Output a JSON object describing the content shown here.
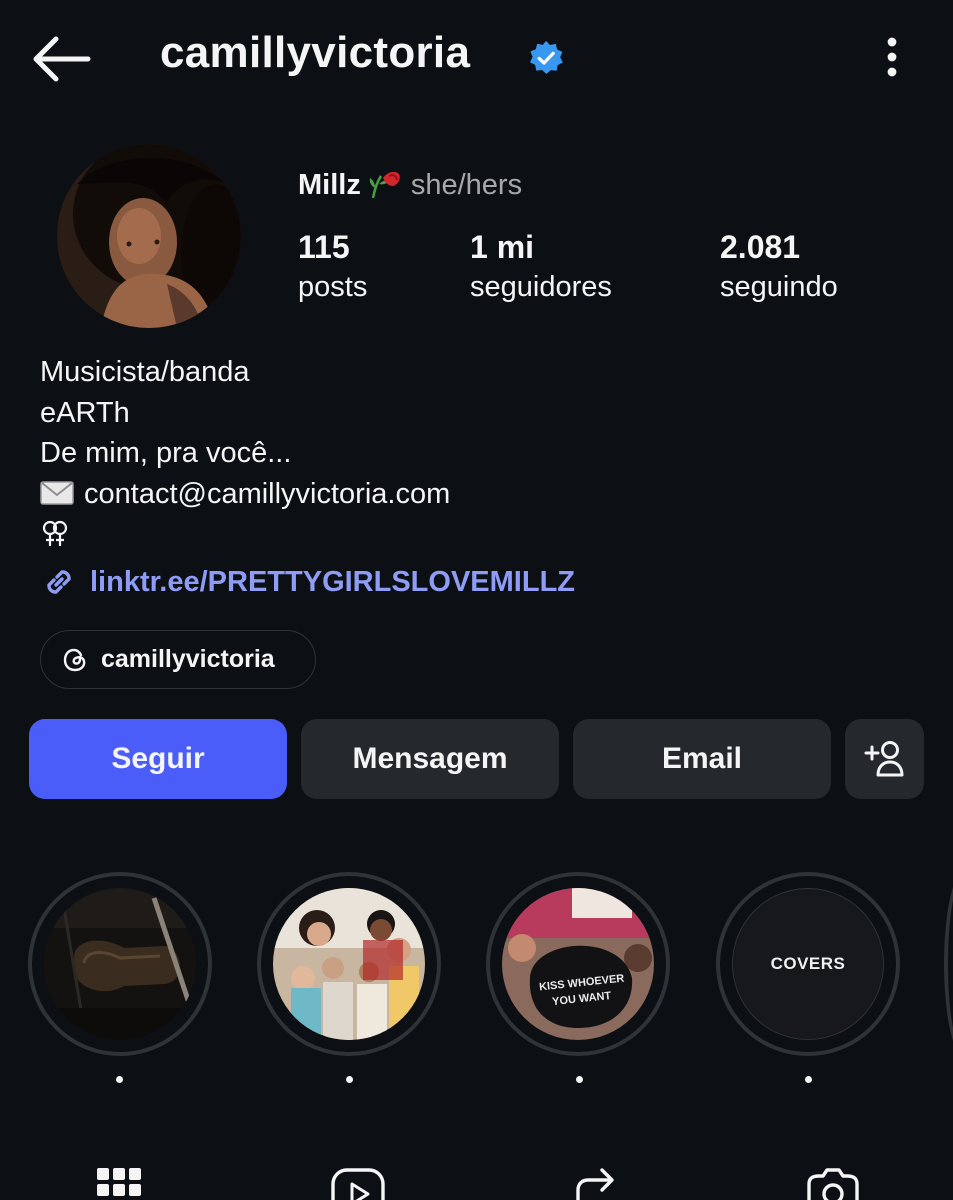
{
  "header": {
    "username": "camillyvictoria",
    "verified_color": "#3897f0"
  },
  "profile": {
    "display_name": "Millz",
    "pronouns": "she/hers",
    "stats": [
      {
        "num": "115",
        "label": "posts"
      },
      {
        "num": "1 mi",
        "label": "seguidores"
      },
      {
        "num": "2.081",
        "label": "seguindo"
      }
    ]
  },
  "bio": {
    "category": "Musicista/banda",
    "lines": [
      "eARTh",
      "De mim, pra você..."
    ],
    "contact": "contact@camillyvictoria.com",
    "link": "linktr.ee/PRETTYGIRLSLOVEMILLZ"
  },
  "threads": {
    "label": "camillyvictoria"
  },
  "buttons": {
    "follow": "Seguir",
    "message": "Mensagem",
    "email": "Email"
  },
  "highlights": [
    {
      "icon": "guitar-case-photo"
    },
    {
      "icon": "family-photo"
    },
    {
      "icon": "cap-photo",
      "text": "KISS WHOEVER YOU WANT"
    },
    {
      "text": "COVERS"
    }
  ],
  "colors": {
    "background": "#0c1014",
    "accent": "#4a5df9",
    "link": "#8e9cf5",
    "secondary_button": "#25292e"
  }
}
